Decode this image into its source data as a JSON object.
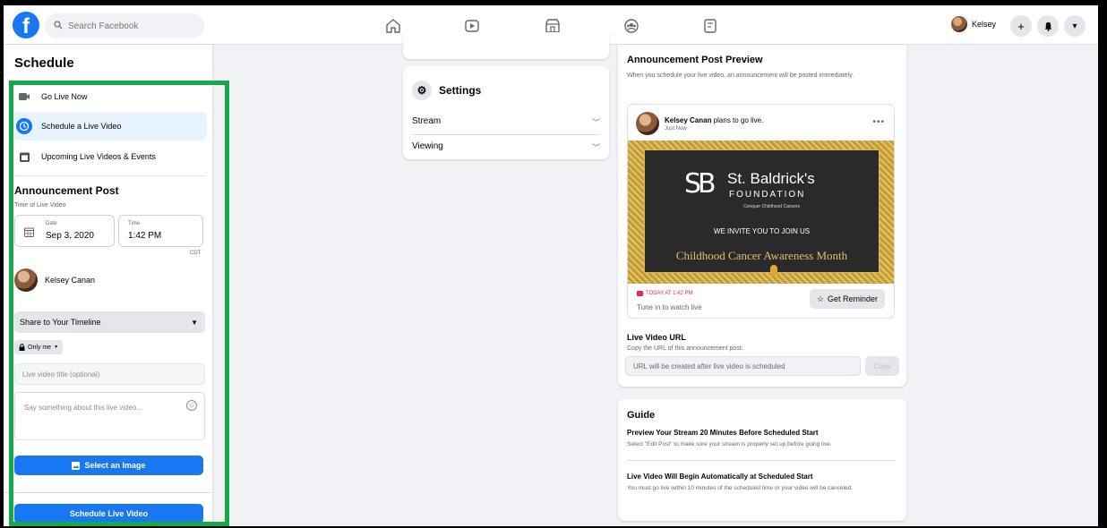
{
  "topbar": {
    "logo": "f",
    "search_placeholder": "Search Facebook",
    "nav_icons": [
      "home-icon",
      "watch-icon",
      "marketplace-icon",
      "groups-icon",
      "gaming-icon"
    ],
    "profile_name": "Kelsey",
    "actions": [
      "+",
      "bell",
      "▾"
    ]
  },
  "sidebar": {
    "title": "Schedule",
    "items": [
      {
        "label": "Go Live Now",
        "icon": "camera-icon"
      },
      {
        "label": "Schedule a Live Video",
        "icon": "clock-icon"
      },
      {
        "label": "Upcoming Live Videos & Events",
        "icon": "calendar-icon"
      }
    ],
    "announcement_title": "Announcement Post",
    "time_label": "Time of Live Video",
    "date_label": "Date",
    "date_value": "Sep 3, 2020",
    "time_field_label": "Time",
    "time_value": "1:42 PM",
    "timezone": "CDT",
    "user_name": "Kelsey Canan",
    "share_select": "Share to Your Timeline",
    "privacy": "Only me",
    "title_placeholder": "Live video title (optional)",
    "description_placeholder": "Say something about this live video...",
    "select_image_label": "Select an Image",
    "schedule_button_label": "Schedule Live Video",
    "highlight_color": "#18a84a"
  },
  "settings": {
    "title": "Settings",
    "rows": [
      "Stream",
      "Viewing"
    ]
  },
  "preview": {
    "title": "Announcement Post Preview",
    "subtitle": "When you schedule your live video, an announcement will be posted immediately.",
    "post_user": "Kelsey Canan",
    "post_action": "plans to go live.",
    "post_time": "Just Now",
    "banner_org_line1": "St. Baldrick's",
    "banner_org_line2": "FOUNDATION",
    "banner_org_line3": "Conquer Childhood Cancers",
    "banner_invite": "WE INVITE YOU TO JOIN US",
    "banner_month": "Childhood Cancer Awareness Month",
    "live_tag": "TODAY AT 1:42 PM",
    "tune_in": "Tune in to watch live",
    "reminder_label": "Get Reminder",
    "url_title": "Live Video URL",
    "url_sub": "Copy the URL of this announcement post.",
    "url_placeholder": "URL will be created after live video is scheduled",
    "copy_label": "Copy"
  },
  "guide": {
    "title": "Guide",
    "items": [
      {
        "heading": "Preview Your Stream 20 Minutes Before Scheduled Start",
        "text": "Select \"Edit Post\" to make sure your stream is properly set up before going live."
      },
      {
        "heading": "Live Video Will Begin Automatically at Scheduled Start",
        "text": "You must go live within 10 minutes of the scheduled time or your video will be canceled."
      }
    ]
  }
}
